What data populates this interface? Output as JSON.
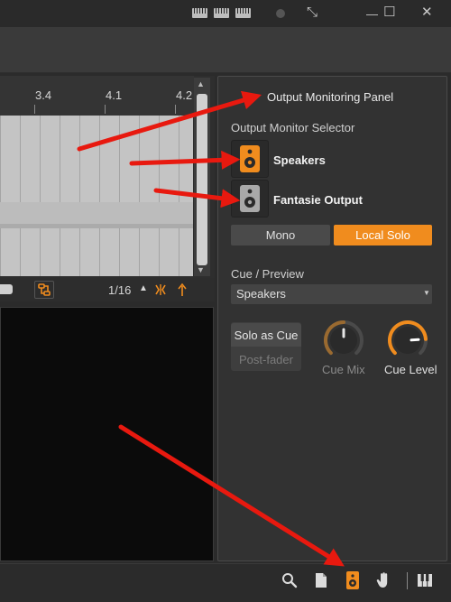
{
  "arranger": {
    "ruler": [
      "3.4",
      "4.1",
      "4.2"
    ],
    "grid_resolution": "1/16"
  },
  "panel": {
    "annotation": "Output Monitoring Panel",
    "section_title": "Output Monitor Selector",
    "outputs": [
      {
        "label": "Speakers",
        "active": true
      },
      {
        "label": "Fantasie Output",
        "active": false
      }
    ],
    "mono_label": "Mono",
    "local_solo_label": "Local Solo",
    "cue_title": "Cue / Preview",
    "cue_select_value": "Speakers",
    "solo_as_cue_label": "Solo as Cue",
    "post_fader_label": "Post-fader",
    "cue_mix_label": "Cue Mix",
    "cue_level_label": "Cue Level",
    "cue_mix_level": 0.5,
    "cue_level_level": 0.82
  },
  "colors": {
    "accent": "#f08c1e",
    "arrow": "#e8190f"
  },
  "icons": {
    "titlebar": [
      "keyboard-icon",
      "keyboard-icon",
      "keyboard-icon",
      "record-dot-icon",
      "fullscreen-icon",
      "maximize-icon",
      "close-icon"
    ],
    "statusbar": [
      "search-icon",
      "document-icon",
      "speaker-icon",
      "hand-icon",
      "piano-icon"
    ]
  }
}
